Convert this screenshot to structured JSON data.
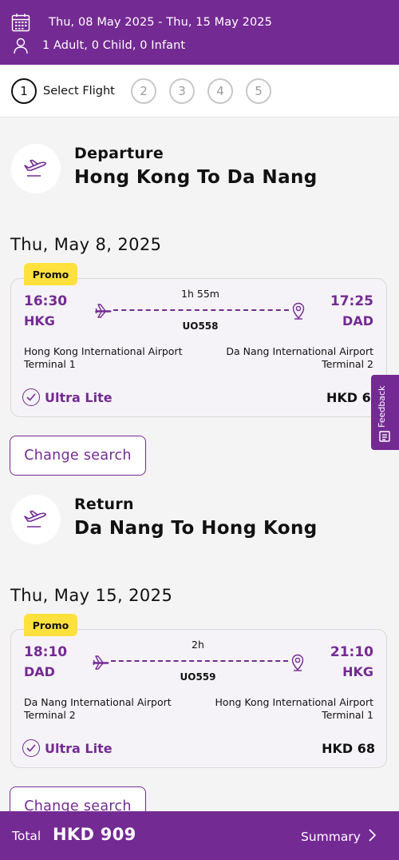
{
  "header": {
    "date_range": "Thu, 08 May 2025  -  Thu, 15 May 2025",
    "passengers": "1 Adult, 0 Child, 0 Infant"
  },
  "steps": {
    "items": [
      "1",
      "2",
      "3",
      "4",
      "5"
    ],
    "active_label": "Select Flight"
  },
  "departure": {
    "label": "Departure",
    "route": "Hong Kong To Da Nang",
    "date": "Thu, May 8, 2025",
    "flight": {
      "badge": "Promo",
      "dep_time": "16:30",
      "dep_code": "HKG",
      "arr_time": "17:25",
      "arr_code": "DAD",
      "duration": "1h 55m",
      "flight_no": "UO558",
      "dep_airport": "Hong Kong International Airport",
      "dep_terminal": "Terminal 1",
      "arr_airport": "Da Nang International Airport",
      "arr_terminal": "Terminal 2",
      "fare": "Ultra Lite",
      "price": "HKD 68"
    },
    "change_label": "Change search"
  },
  "return": {
    "label": "Return",
    "route": "Da Nang To Hong Kong",
    "date": "Thu, May 15, 2025",
    "flight": {
      "badge": "Promo",
      "dep_time": "18:10",
      "dep_code": "DAD",
      "arr_time": "21:10",
      "arr_code": "HKG",
      "duration": "2h",
      "flight_no": "UO559",
      "dep_airport": "Da Nang International Airport",
      "dep_terminal": "Terminal 2",
      "arr_airport": "Hong Kong International Airport",
      "arr_terminal": "Terminal 1",
      "fare": "Ultra Lite",
      "price": "HKD 68"
    },
    "change_label": "Change search"
  },
  "feedback": {
    "label": "Feedback"
  },
  "footer": {
    "total_label": "Total",
    "total_value": "HKD 909",
    "summary_label": "Summary"
  },
  "colors": {
    "brand_purple": "#742a93",
    "promo_yellow": "#ffe13d",
    "page_bg": "#f4f4f4"
  },
  "icons": [
    "calendar-icon",
    "person-icon",
    "plane-takeoff-icon",
    "plane-icon",
    "location-pin-icon",
    "check-circle-icon",
    "feedback-icon",
    "chevron-right-icon"
  ]
}
